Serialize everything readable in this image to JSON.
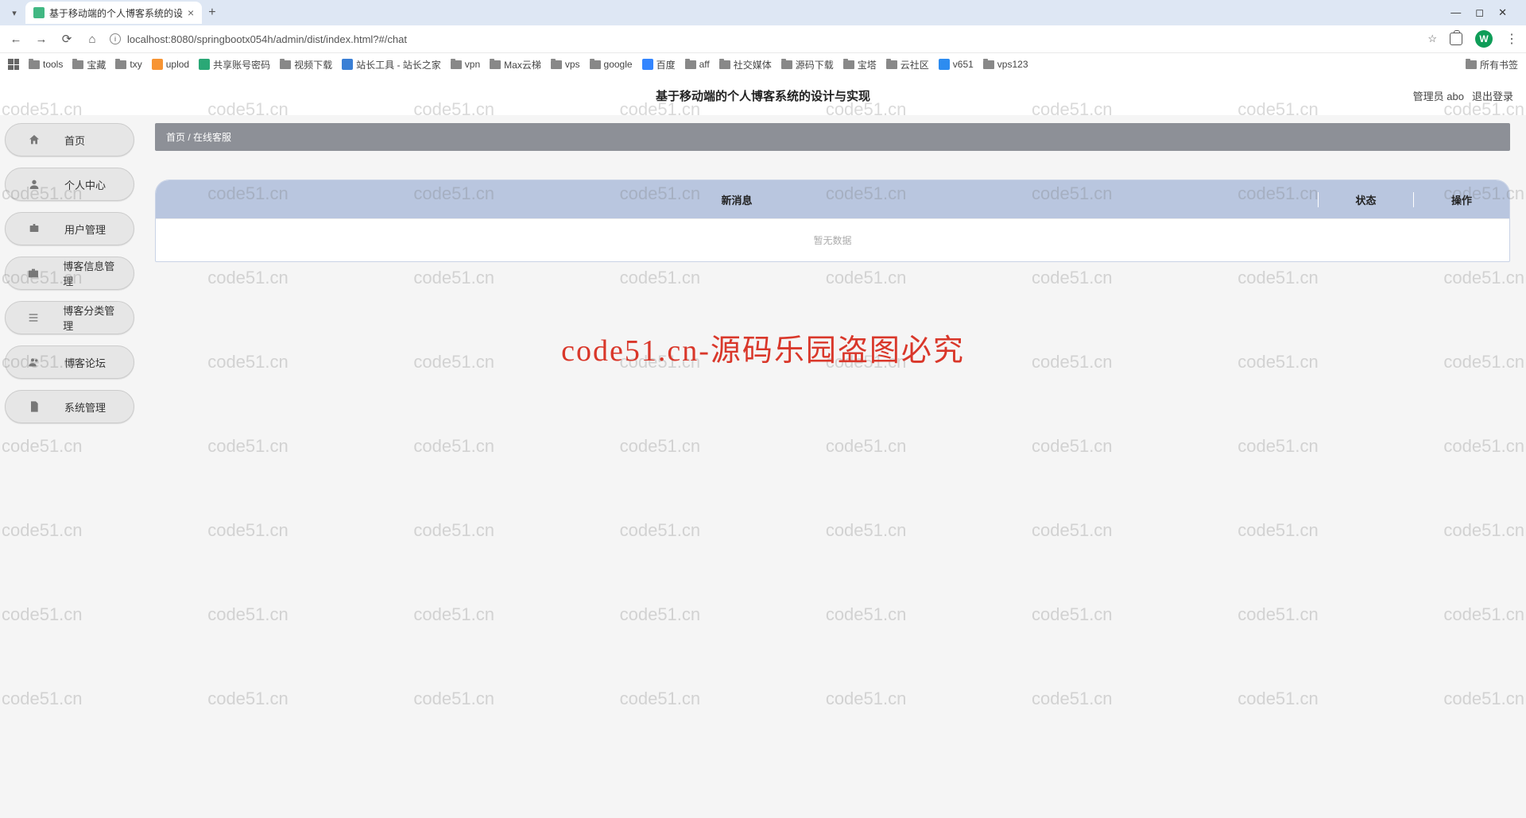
{
  "browser": {
    "tab_title": "基于移动端的个人博客系统的设",
    "url": "localhost:8080/springbootx054h/admin/dist/index.html?#/chat",
    "profile_letter": "W",
    "all_bookmarks": "所有书签",
    "bookmarks": [
      {
        "type": "folder",
        "label": "tools"
      },
      {
        "type": "folder",
        "label": "宝藏"
      },
      {
        "type": "folder",
        "label": "txy"
      },
      {
        "type": "icon",
        "label": "uplod",
        "color": "#f79433"
      },
      {
        "type": "icon",
        "label": "共享账号密码",
        "color": "#2aa876"
      },
      {
        "type": "folder",
        "label": "视频下载"
      },
      {
        "type": "icon",
        "label": "站长工具 - 站长之家",
        "color": "#3a7fd5"
      },
      {
        "type": "folder",
        "label": "vpn"
      },
      {
        "type": "folder",
        "label": "Max云梯"
      },
      {
        "type": "folder",
        "label": "vps"
      },
      {
        "type": "folder",
        "label": "google"
      },
      {
        "type": "icon",
        "label": "百度",
        "color": "#3385ff"
      },
      {
        "type": "folder",
        "label": "aff"
      },
      {
        "type": "folder",
        "label": "社交媒体"
      },
      {
        "type": "folder",
        "label": "源码下载"
      },
      {
        "type": "folder",
        "label": "宝塔"
      },
      {
        "type": "folder",
        "label": "云社区"
      },
      {
        "type": "icon",
        "label": "v651",
        "color": "#2d8cf0"
      },
      {
        "type": "folder",
        "label": "vps123"
      }
    ]
  },
  "header": {
    "title": "基于移动端的个人博客系统的设计与实现",
    "user_label": "管理员 abo",
    "logout": "退出登录"
  },
  "sidebar": {
    "items": [
      {
        "label": "首页",
        "icon": "home"
      },
      {
        "label": "个人中心",
        "icon": "person"
      },
      {
        "label": "用户管理",
        "icon": "badge"
      },
      {
        "label": "博客信息管理",
        "icon": "briefcase"
      },
      {
        "label": "博客分类管理",
        "icon": "list"
      },
      {
        "label": "博客论坛",
        "icon": "people"
      },
      {
        "label": "系统管理",
        "icon": "doc"
      }
    ]
  },
  "breadcrumb": {
    "home": "首页",
    "sep": " / ",
    "current": "在线客服"
  },
  "table": {
    "col_msg": "新消息",
    "col_status": "状态",
    "col_op": "操作",
    "empty": "暂无数据"
  },
  "watermark": {
    "repeat": "code51.cn",
    "center": "code51.cn-源码乐园盗图必究"
  }
}
